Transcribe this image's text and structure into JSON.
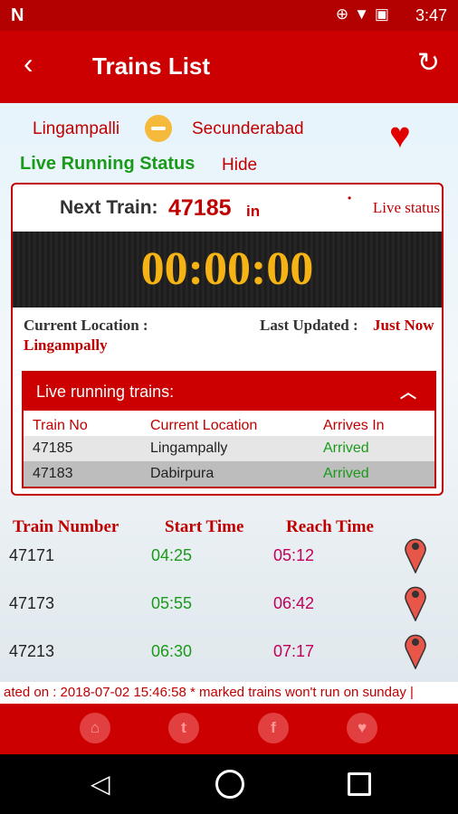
{
  "status_bar": {
    "notification_badge": "N",
    "time": "3:47"
  },
  "app_bar": {
    "title": "Trains List",
    "back_label": "‹",
    "refresh_label": "↻"
  },
  "route": {
    "from": "Lingampalli",
    "to": "Secunderabad"
  },
  "live_running_status": {
    "label": "Live Running Status",
    "hide_label": "Hide"
  },
  "next_train": {
    "label": "Next Train:",
    "number": "47185",
    "suffix": "in",
    "dot": "•",
    "live_status_link": "Live status",
    "countdown": "00:00:00",
    "current_location_label": "Current Location :",
    "current_location_value": "Lingampally",
    "last_updated_label": "Last Updated :",
    "last_updated_value": "Just Now"
  },
  "live_trains_panel": {
    "title": "Live running trains:",
    "columns": [
      "Train No",
      "Current Location",
      "Arrives In"
    ],
    "rows": [
      {
        "train_no": "47185",
        "location": "Lingampally",
        "arrives": "Arrived"
      },
      {
        "train_no": "47183",
        "location": "Dabirpura",
        "arrives": "Arrived"
      }
    ]
  },
  "trains_table": {
    "columns": [
      "Train Number",
      "Start Time",
      "Reach Time"
    ],
    "rows": [
      {
        "number": "47171",
        "start": "04:25",
        "reach": "05:12"
      },
      {
        "number": "47173",
        "start": "05:55",
        "reach": "06:42"
      },
      {
        "number": "47213",
        "start": "06:30",
        "reach": "07:17"
      }
    ]
  },
  "ticker": "ated on : 2018-07-02 15:46:58 * marked trains won't run on sunday |",
  "bottom_bar": {
    "home": "⌂",
    "twitter": "t",
    "facebook": "f",
    "favorite": "♥"
  },
  "nav_bar": {
    "back": "◁"
  },
  "colors": {
    "primary": "#cc0000",
    "status_bar": "#b30000",
    "green": "#1a9a1a",
    "countdown": "#f5b316"
  }
}
